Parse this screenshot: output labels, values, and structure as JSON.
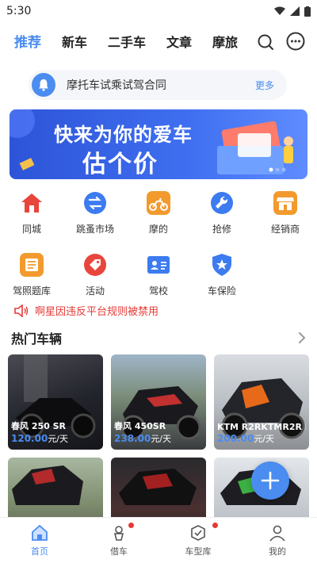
{
  "status_bar": {
    "time": "5:30"
  },
  "top_nav": {
    "tabs": [
      {
        "label": "推荐",
        "active": true
      },
      {
        "label": "新车",
        "active": false
      },
      {
        "label": "二手车",
        "active": false
      },
      {
        "label": "文章",
        "active": false
      },
      {
        "label": "摩旅",
        "active": false
      }
    ]
  },
  "notice": {
    "text": "摩托车试乘试驾合同",
    "more": "更多"
  },
  "banner": {
    "line1": "快来为你的爱车",
    "line2": "估个价"
  },
  "grid": {
    "row1": [
      {
        "label": "同城",
        "icon": "home-icon",
        "color": "#e8453c"
      },
      {
        "label": "跳蚤市场",
        "icon": "swap-icon",
        "color": "#3c7bf0"
      },
      {
        "label": "摩的",
        "icon": "motorbike-icon",
        "color": "#f29a2e"
      },
      {
        "label": "抢修",
        "icon": "wrench-icon",
        "color": "#3c7bf0"
      },
      {
        "label": "经销商",
        "icon": "store-icon",
        "color": "#f29a2e"
      }
    ],
    "row2": [
      {
        "label": "驾照题库",
        "icon": "list-icon",
        "color": "#f29a2e"
      },
      {
        "label": "活动",
        "icon": "tag-icon",
        "color": "#e8453c"
      },
      {
        "label": "驾校",
        "icon": "id-card-icon",
        "color": "#3c7bf0"
      },
      {
        "label": "车保险",
        "icon": "shield-star-icon",
        "color": "#3c7bf0"
      }
    ]
  },
  "ticker": {
    "text": "啊星因违反平台规则被禁用"
  },
  "hot": {
    "title": "热门车辆",
    "cards": [
      {
        "name": "春风 250 SR",
        "price": "120.00",
        "unit": "元/天"
      },
      {
        "name": "春风 450SR",
        "price": "238.00",
        "unit": "元/天"
      },
      {
        "name": "KTM R2RKTMR2R R...",
        "price": "200.00",
        "unit": "元/天"
      },
      {
        "name": "",
        "price": "",
        "unit": ""
      },
      {
        "name": "",
        "price": "",
        "unit": ""
      },
      {
        "name": "",
        "price": "",
        "unit": ""
      }
    ]
  },
  "bottom_nav": {
    "items": [
      {
        "label": "首页",
        "active": true
      },
      {
        "label": "借车",
        "active": false
      },
      {
        "label": "车型库",
        "active": false
      },
      {
        "label": "我的",
        "active": false
      }
    ]
  },
  "colors": {
    "accent": "#4a8cf0",
    "alert": "#e53935"
  }
}
